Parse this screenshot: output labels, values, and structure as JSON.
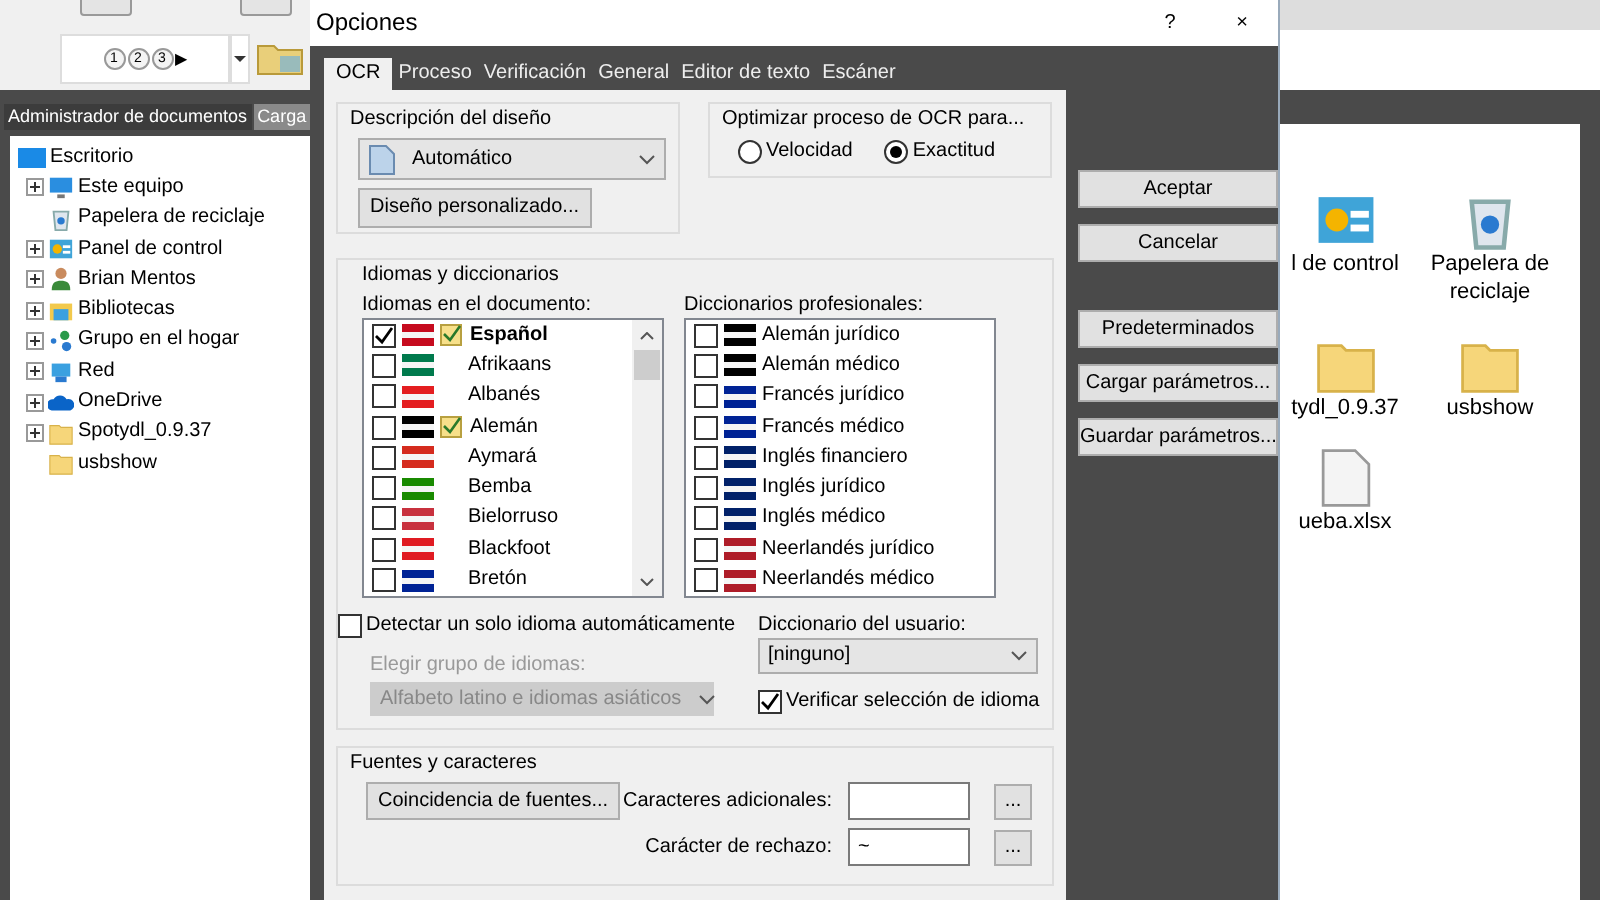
{
  "background_app": {
    "toolbar": {
      "steps": [
        "1",
        "2",
        "3"
      ],
      "arrow": "▶"
    },
    "tabs": [
      {
        "label": "Administrador de documentos",
        "selected": true
      },
      {
        "label": "Carga",
        "selected": false
      }
    ],
    "tree": {
      "label": "Escritorio",
      "children": [
        {
          "label": "Este equipo",
          "kind": "computer",
          "expandable": true
        },
        {
          "label": "Papelera de reciclaje",
          "kind": "recycle",
          "expandable": false
        },
        {
          "label": "Panel de control",
          "kind": "control",
          "expandable": true
        },
        {
          "label": "Brian Mentos",
          "kind": "user",
          "expandable": true
        },
        {
          "label": "Bibliotecas",
          "kind": "library",
          "expandable": true
        },
        {
          "label": "Grupo en el hogar",
          "kind": "homegroup",
          "expandable": true
        },
        {
          "label": "Red",
          "kind": "network",
          "expandable": true
        },
        {
          "label": "OneDrive",
          "kind": "cloud",
          "expandable": true
        },
        {
          "label": "Spotydl_0.9.37",
          "kind": "folder",
          "expandable": true
        },
        {
          "label": "usbshow",
          "kind": "folder",
          "expandable": false
        }
      ]
    },
    "desktop_icons": [
      {
        "label": "l de control",
        "kind": "control"
      },
      {
        "label": "Papelera de reciclaje",
        "kind": "recycle"
      },
      {
        "label": "tydl_0.9.37",
        "kind": "folder"
      },
      {
        "label": "usbshow",
        "kind": "folder"
      },
      {
        "label": "ueba.xlsx",
        "kind": "file"
      }
    ]
  },
  "dialog": {
    "title": "Opciones",
    "help": "?",
    "close": "×",
    "tabs": [
      {
        "label": "OCR",
        "selected": true
      },
      {
        "label": "Proceso",
        "selected": false
      },
      {
        "label": "Verificación",
        "selected": false
      },
      {
        "label": "General",
        "selected": false
      },
      {
        "label": "Editor de texto",
        "selected": false
      },
      {
        "label": "Escáner",
        "selected": false
      }
    ],
    "layout_group": {
      "title": "Descripción del diseño",
      "select": "Automático",
      "button": "Diseño personalizado..."
    },
    "optimize_group": {
      "title": "Optimizar proceso de OCR para...",
      "options": [
        {
          "label": "Velocidad",
          "selected": false
        },
        {
          "label": "Exactitud",
          "selected": true
        }
      ]
    },
    "languages_group": {
      "title": "Idiomas y diccionarios",
      "languages_label": "Idiomas en el documento:",
      "languages": [
        {
          "name": "Español",
          "checked": true,
          "verified": true,
          "color": "#c60b1e"
        },
        {
          "name": "Afrikaans",
          "checked": false,
          "verified": false,
          "color": "#007a4d"
        },
        {
          "name": "Albanés",
          "checked": false,
          "verified": false,
          "color": "#e41e20"
        },
        {
          "name": "Alemán",
          "checked": false,
          "verified": true,
          "color": "#000000"
        },
        {
          "name": "Aymará",
          "checked": false,
          "verified": false,
          "color": "#d52b1e"
        },
        {
          "name": "Bemba",
          "checked": false,
          "verified": false,
          "color": "#198a00"
        },
        {
          "name": "Bielorruso",
          "checked": false,
          "verified": false,
          "color": "#c8313e"
        },
        {
          "name": "Blackfoot",
          "checked": false,
          "verified": false,
          "color": "#e01b22"
        },
        {
          "name": "Bretón",
          "checked": false,
          "verified": false,
          "color": "#002395"
        }
      ],
      "dictionaries_label": "Diccionarios profesionales:",
      "dictionaries": [
        {
          "name": "Alemán jurídico",
          "checked": false,
          "color": "#000000"
        },
        {
          "name": "Alemán médico",
          "checked": false,
          "color": "#000000"
        },
        {
          "name": "Francés jurídico",
          "checked": false,
          "color": "#002395"
        },
        {
          "name": "Francés médico",
          "checked": false,
          "color": "#002395"
        },
        {
          "name": "Inglés financiero",
          "checked": false,
          "color": "#012169"
        },
        {
          "name": "Inglés jurídico",
          "checked": false,
          "color": "#012169"
        },
        {
          "name": "Inglés médico",
          "checked": false,
          "color": "#012169"
        },
        {
          "name": "Neerlandés jurídico",
          "checked": false,
          "color": "#ae1c28"
        },
        {
          "name": "Neerlandés médico",
          "checked": false,
          "color": "#ae1c28"
        }
      ],
      "detect_single": {
        "label": "Detectar un solo idioma automáticamente",
        "checked": false
      },
      "group_label": "Elegir grupo de idiomas:",
      "group_select": {
        "value": "Alfabeto latino e idiomas asiáticos",
        "disabled": true
      },
      "user_dict_label": "Diccionario del usuario:",
      "user_dict_select": "[ninguno]",
      "verify": {
        "label": "Verificar selección de idioma",
        "checked": true
      }
    },
    "fonts_group": {
      "title": "Fuentes y caracteres",
      "button": "Coincidencia de fuentes...",
      "fields": [
        {
          "label": "Caracteres adicionales:",
          "browse": "..."
        },
        {
          "label": "Carácter de rechazo:",
          "value": "~",
          "browse": "..."
        }
      ]
    },
    "button_groups": [
      [
        "Aceptar",
        "Cancelar"
      ],
      [
        "Predeterminados",
        "Cargar parámetros...",
        "Guardar parámetros..."
      ]
    ]
  }
}
